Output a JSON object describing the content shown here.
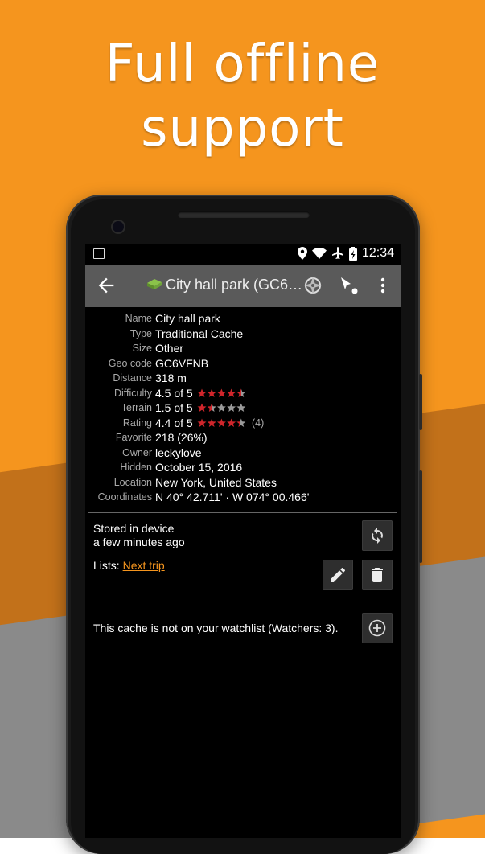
{
  "headline": {
    "line1": "Full offline",
    "line2": "support"
  },
  "statusbar": {
    "time": "12:34"
  },
  "appbar": {
    "title": "City hall park (GC6…"
  },
  "details": [
    {
      "label": "Name",
      "value": "City hall park"
    },
    {
      "label": "Type",
      "value": "Traditional Cache"
    },
    {
      "label": "Size",
      "value": "Other"
    },
    {
      "label": "Geo code",
      "value": "GC6VFNB"
    },
    {
      "label": "Distance",
      "value": "318 m"
    },
    {
      "label": "Difficulty",
      "value": "4.5 of 5",
      "stars": 4.5
    },
    {
      "label": "Terrain",
      "value": "1.5 of 5",
      "stars": 1.5
    },
    {
      "label": "Rating",
      "value": "4.4 of 5",
      "stars": 4.4,
      "count": "(4)"
    },
    {
      "label": "Favorite",
      "value": "218 (26%)"
    },
    {
      "label": "Owner",
      "value": "leckylove"
    },
    {
      "label": "Hidden",
      "value": "October 15, 2016"
    },
    {
      "label": "Location",
      "value": "New York, United States"
    },
    {
      "label": "Coordinates",
      "value": "N 40° 42.711' · W 074° 00.466'"
    }
  ],
  "storage": {
    "line1": "Stored in device",
    "line2": "a few minutes ago",
    "lists_label": "Lists:",
    "list_link": "Next trip"
  },
  "watchlist": {
    "text": "This cache is not on your watchlist (Watchers: 3)."
  },
  "colors": {
    "orange": "#F5951E",
    "star_red": "#D0252B",
    "star_gray": "#9a9a9a"
  }
}
